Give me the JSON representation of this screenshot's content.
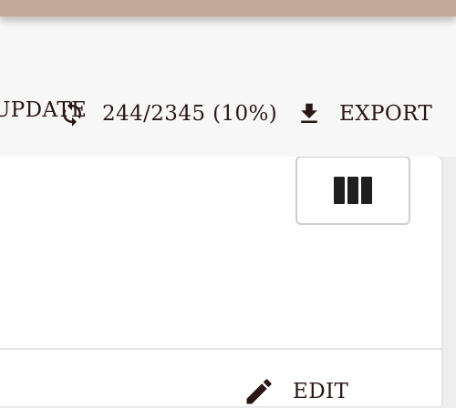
{
  "toolbar": {
    "update_label": "UPDATE",
    "progress_label": "244/2345 (10%)",
    "export_label": "EXPORT",
    "icons": {
      "progress": "refresh-icon",
      "export": "download-icon"
    }
  },
  "table": {
    "columns_icon": "columns-icon",
    "edit_label": "EDIT",
    "edit_icon": "pencil-icon"
  },
  "colors": {
    "top_strip": "#c2a999",
    "toolbar_bg": "#f7f7f7",
    "text": "#2a1714",
    "card_bg": "#ffffff"
  }
}
